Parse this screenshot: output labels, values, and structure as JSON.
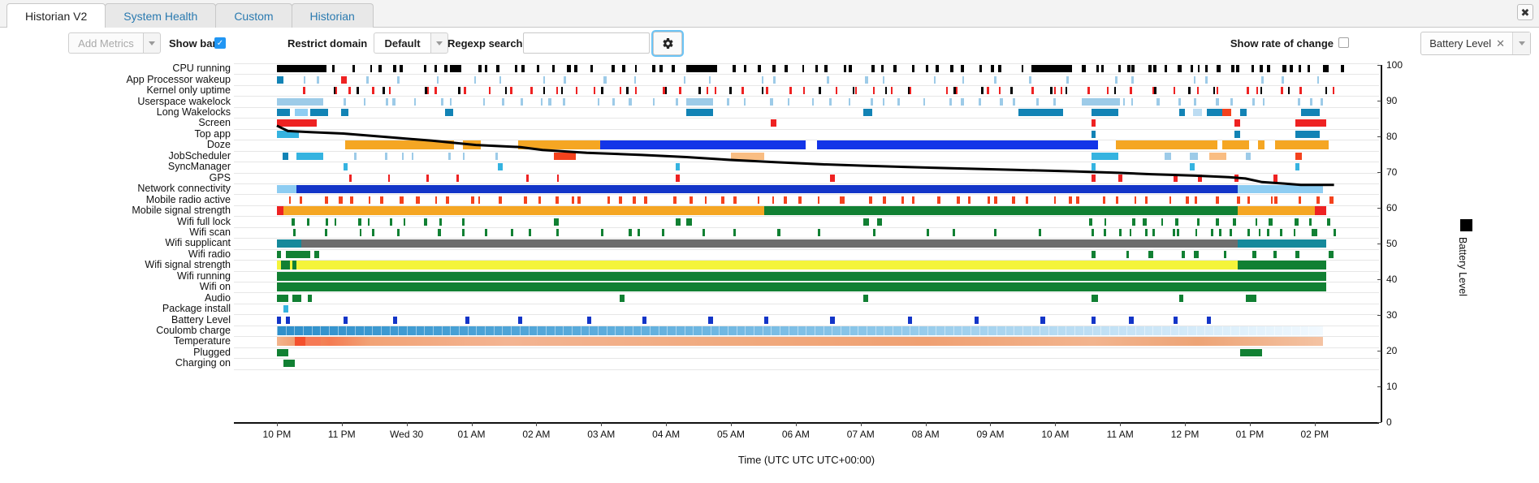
{
  "window": {
    "close_label": "✖"
  },
  "tabs": [
    {
      "label": "Historian V2",
      "active": true
    },
    {
      "label": "System Health",
      "active": false
    },
    {
      "label": "Custom",
      "active": false
    },
    {
      "label": "Historian",
      "active": false
    }
  ],
  "toolbar": {
    "add_metrics_label": "Add Metrics",
    "show_bars_label": "Show bars",
    "show_bars_checked": true,
    "show_bars_glyph": "✓",
    "restrict_domain_label": "Restrict domain",
    "restrict_domain_value": "Default",
    "regexp_search_label": "Regexp search",
    "regexp_search_value": "",
    "regexp_search_placeholder": "",
    "settings_icon": "gear-icon",
    "settings_glyph": "⚙",
    "show_rate_of_change_label": "Show rate of change",
    "show_rate_of_change_checked": false,
    "metric_chip_label": "Battery Level",
    "metric_chip_remove_glyph": "✕"
  },
  "chart_data": {
    "type": "timeline",
    "title": "",
    "xlabel": "Time (UTC UTC UTC+00:00)",
    "ylabel": "Battery Level",
    "ylim": [
      0,
      100
    ],
    "y_ticks": [
      0,
      10,
      20,
      30,
      40,
      50,
      60,
      70,
      80,
      90,
      100
    ],
    "x_ticks": [
      "10 PM",
      "11 PM",
      "Wed 30",
      "01 AM",
      "02 AM",
      "03 AM",
      "04 AM",
      "05 AM",
      "06 AM",
      "07 AM",
      "08 AM",
      "09 AM",
      "10 AM",
      "11 AM",
      "12 PM",
      "01 PM",
      "02 PM"
    ],
    "legend": [
      {
        "label": "Battery Level",
        "color": "#000000"
      }
    ],
    "battery_level_series": {
      "name": "Battery Level",
      "color": "#000000",
      "points": [
        [
          0.03,
          83.0
        ],
        [
          0.04,
          81.5
        ],
        [
          0.06,
          81.2
        ],
        [
          0.09,
          80.8
        ],
        [
          0.13,
          79.8
        ],
        [
          0.17,
          78.8
        ],
        [
          0.21,
          77.6
        ],
        [
          0.25,
          77.0
        ],
        [
          0.27,
          76.2
        ],
        [
          0.31,
          75.4
        ],
        [
          0.36,
          74.8
        ],
        [
          0.4,
          74.2
        ],
        [
          0.44,
          73.4
        ],
        [
          0.48,
          72.8
        ],
        [
          0.52,
          72.2
        ],
        [
          0.56,
          71.8
        ],
        [
          0.6,
          71.4
        ],
        [
          0.65,
          71.0
        ],
        [
          0.7,
          70.6
        ],
        [
          0.75,
          70.2
        ],
        [
          0.79,
          69.8
        ],
        [
          0.82,
          69.4
        ],
        [
          0.86,
          69.0
        ],
        [
          0.89,
          68.6
        ],
        [
          0.905,
          68.2
        ],
        [
          0.92,
          67.2
        ],
        [
          0.94,
          66.8
        ],
        [
          0.955,
          66.4
        ],
        [
          0.97,
          66.4
        ],
        [
          0.985,
          66.4
        ]
      ]
    },
    "rows": [
      {
        "label": "CPU running",
        "color": "#000000"
      },
      {
        "label": "App Processor wakeup",
        "color": "#9dcbe8"
      },
      {
        "label": "Kernel only uptime",
        "color": "#ee2222"
      },
      {
        "label": "Userspace wakelock",
        "color": "#9dcbe8"
      },
      {
        "label": "Long Wakelocks",
        "color": "#1283b5"
      },
      {
        "label": "Screen",
        "color": "#ee2222"
      },
      {
        "label": "Top app",
        "color": "#4aa3c7"
      },
      {
        "label": "Doze",
        "color": "#1335e8"
      },
      {
        "label": "JobScheduler",
        "color": "#9dcbe8"
      },
      {
        "label": "SyncManager",
        "color": "#35b3e0"
      },
      {
        "label": "GPS",
        "color": "#ee2222"
      },
      {
        "label": "Network connectivity",
        "color": "#1335c8"
      },
      {
        "label": "Mobile radio active",
        "color": "#f4421d"
      },
      {
        "label": "Mobile signal strength",
        "color": "#f5a623"
      },
      {
        "label": "Wifi full lock",
        "color": "#118033"
      },
      {
        "label": "Wifi scan",
        "color": "#118033"
      },
      {
        "label": "Wifi supplicant",
        "color": "#6d6d6d"
      },
      {
        "label": "Wifi radio",
        "color": "#118033"
      },
      {
        "label": "Wifi signal strength",
        "color": "#f4f43a"
      },
      {
        "label": "Wifi running",
        "color": "#118033"
      },
      {
        "label": "Wifi on",
        "color": "#118033"
      },
      {
        "label": "Audio",
        "color": "#118033"
      },
      {
        "label": "Package install",
        "color": "#35b3e0"
      },
      {
        "label": "Battery Level",
        "color": "#1335c8"
      },
      {
        "label": "Coulomb charge",
        "color": "#5eaede"
      },
      {
        "label": "Temperature",
        "color": "#f0a97d"
      },
      {
        "label": "Plugged",
        "color": "#118033"
      },
      {
        "label": "Charging on",
        "color": "#118033"
      }
    ]
  }
}
